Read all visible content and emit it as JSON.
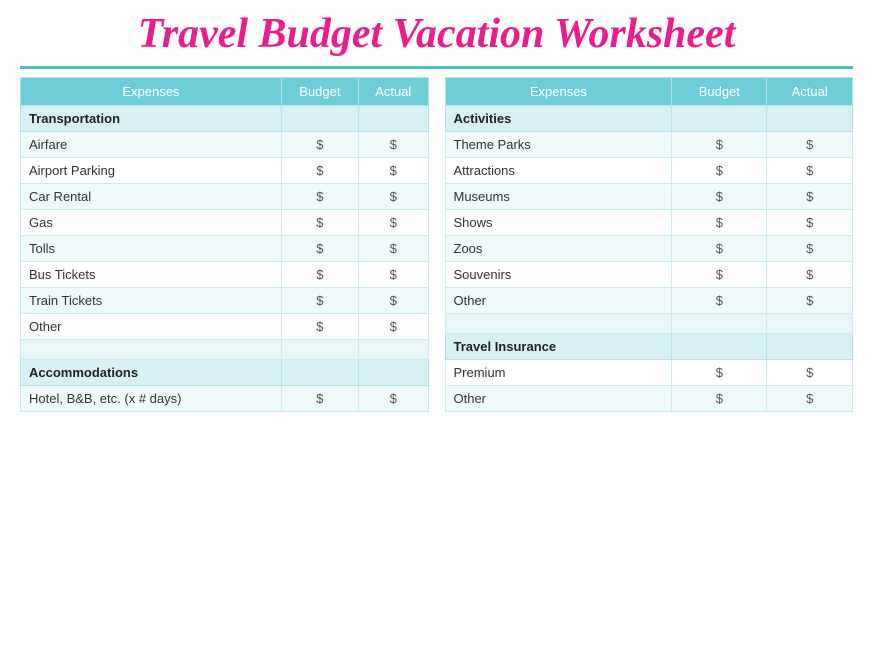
{
  "title": "Travel Budget Vacation Worksheet",
  "left_table": {
    "headers": [
      "Expenses",
      "Budget",
      "Actual"
    ],
    "sections": [
      {
        "type": "section-header",
        "label": "Transportation",
        "budget": "",
        "actual": ""
      },
      {
        "type": "row",
        "label": "Airfare",
        "budget": "$",
        "actual": "$"
      },
      {
        "type": "row",
        "label": "Airport Parking",
        "budget": "$",
        "actual": "$"
      },
      {
        "type": "row",
        "label": "Car Rental",
        "budget": "$",
        "actual": "$"
      },
      {
        "type": "row",
        "label": "Gas",
        "budget": "$",
        "actual": "$"
      },
      {
        "type": "row",
        "label": "Tolls",
        "budget": "$",
        "actual": "$"
      },
      {
        "type": "row",
        "label": "Bus Tickets",
        "budget": "$",
        "actual": "$"
      },
      {
        "type": "row",
        "label": "Train Tickets",
        "budget": "$",
        "actual": "$"
      },
      {
        "type": "row",
        "label": "Other",
        "budget": "$",
        "actual": "$"
      },
      {
        "type": "empty",
        "label": "",
        "budget": "",
        "actual": ""
      },
      {
        "type": "section-header",
        "label": "Accommodations",
        "budget": "",
        "actual": ""
      },
      {
        "type": "row",
        "label": "Hotel, B&B, etc. (x # days)",
        "budget": "$",
        "actual": "$"
      }
    ]
  },
  "right_table": {
    "headers": [
      "Expenses",
      "Budget",
      "Actual"
    ],
    "sections": [
      {
        "type": "section-header",
        "label": "Activities",
        "budget": "",
        "actual": ""
      },
      {
        "type": "row",
        "label": "Theme Parks",
        "budget": "$",
        "actual": "$"
      },
      {
        "type": "row",
        "label": "Attractions",
        "budget": "$",
        "actual": "$"
      },
      {
        "type": "row",
        "label": "Museums",
        "budget": "$",
        "actual": "$"
      },
      {
        "type": "row",
        "label": "Shows",
        "budget": "$",
        "actual": "$"
      },
      {
        "type": "row",
        "label": "Zoos",
        "budget": "$",
        "actual": "$"
      },
      {
        "type": "row",
        "label": "Souvenirs",
        "budget": "$",
        "actual": "$"
      },
      {
        "type": "row",
        "label": "Other",
        "budget": "$",
        "actual": "$"
      },
      {
        "type": "empty",
        "label": "",
        "budget": "",
        "actual": ""
      },
      {
        "type": "section-header",
        "label": "Travel Insurance",
        "budget": "",
        "actual": ""
      },
      {
        "type": "row",
        "label": "Premium",
        "budget": "$",
        "actual": "$"
      },
      {
        "type": "row",
        "label": "Other",
        "budget": "$",
        "actual": "$"
      }
    ]
  }
}
